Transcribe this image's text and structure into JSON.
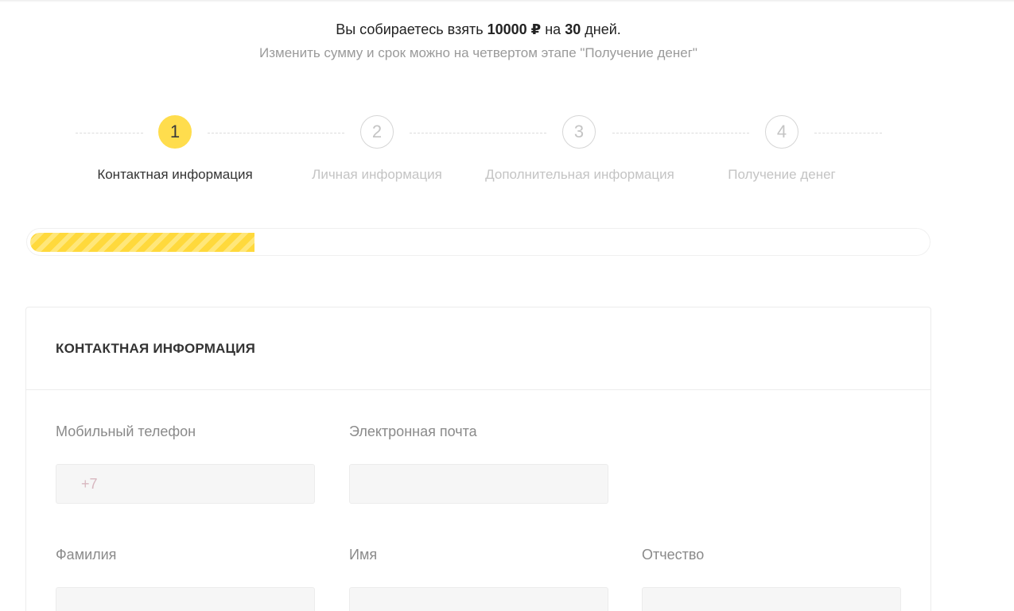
{
  "loan_summary": {
    "prefix": "Вы собираетесь взять",
    "amount": "10000 ₽",
    "middle": "на",
    "days": "30",
    "suffix": "дней."
  },
  "hint": "Изменить сумму и срок можно на четвертом этапе \"Получение денег\"",
  "steps": [
    {
      "number": "1",
      "label": "Контактная информация",
      "active": true
    },
    {
      "number": "2",
      "label": "Личная информация",
      "active": false
    },
    {
      "number": "3",
      "label": "Дополнительная информация",
      "active": false
    },
    {
      "number": "4",
      "label": "Получение денег",
      "active": false
    }
  ],
  "progress": {
    "fraction": 0.25
  },
  "colors": {
    "accent": "#ffdd4d",
    "muted_text": "#c4c4c4"
  },
  "form": {
    "section_title": "КОНТАКТНАЯ ИНФОРМАЦИЯ",
    "phone": {
      "label": "Мобильный телефон",
      "placeholder": "+7",
      "value": ""
    },
    "email": {
      "label": "Электронная почта",
      "placeholder": "",
      "value": ""
    },
    "last_name": {
      "label": "Фамилия",
      "placeholder": "",
      "value": ""
    },
    "first_name": {
      "label": "Имя",
      "placeholder": "",
      "value": ""
    },
    "middle_name": {
      "label": "Отчество",
      "placeholder": "",
      "value": ""
    }
  }
}
